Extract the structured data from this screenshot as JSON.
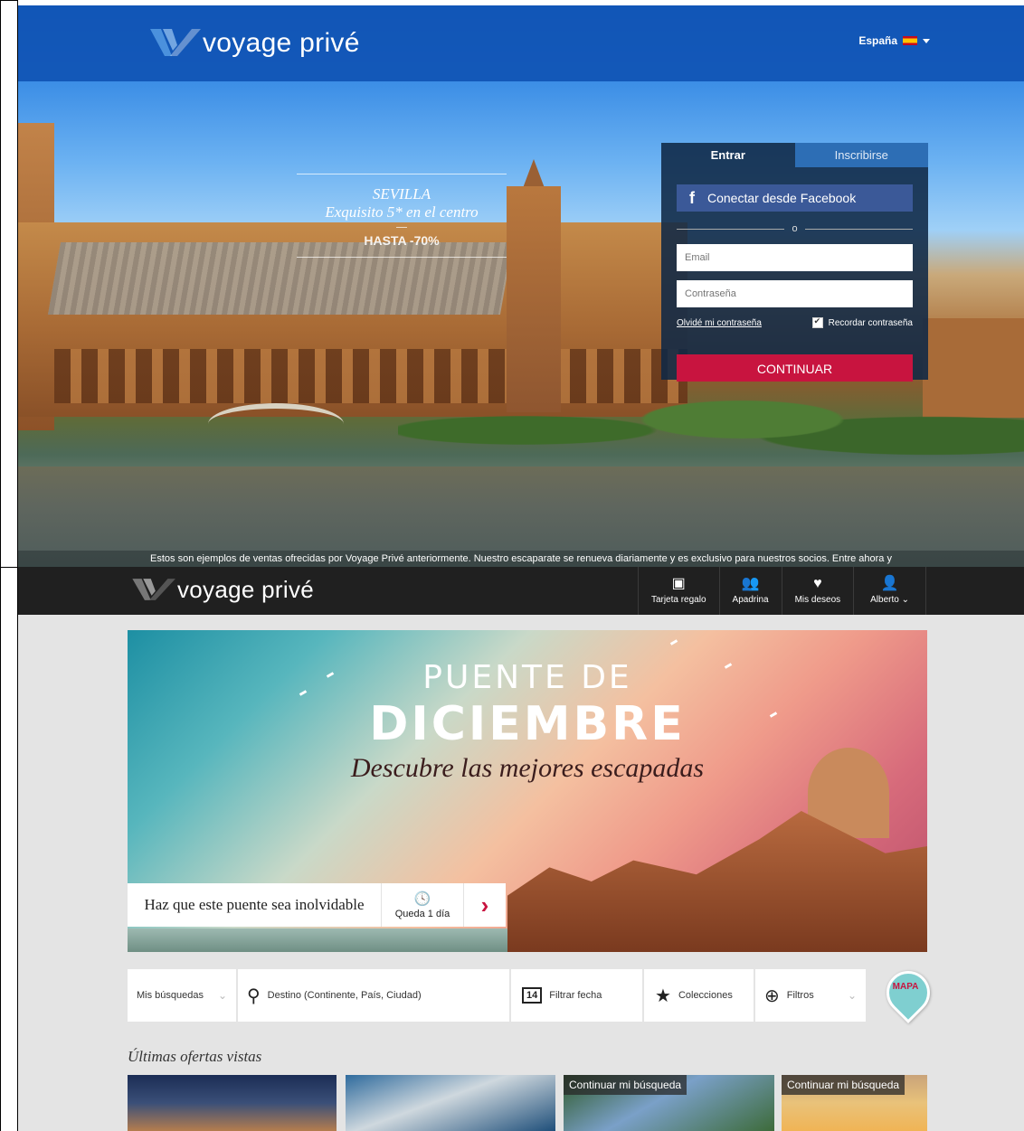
{
  "landing": {
    "logo_text": "voyage privé",
    "country": "España",
    "promo": {
      "city": "SEVILLA",
      "subtitle": "Exquisito 5* en el centro",
      "discount": "HASTA -70%"
    },
    "login": {
      "tab_login": "Entrar",
      "tab_signup": "Inscribirse",
      "facebook_label": "Conectar desde Facebook",
      "or_label": "o",
      "email_placeholder": "Email",
      "password_placeholder": "Contraseña",
      "forgot_label": "Olvidé mi contraseña",
      "remember_label": "Recordar contraseña",
      "continue_label": "CONTINUAR"
    },
    "disclaimer": "Estos son ejemplos de ventas ofrecidas por Voyage Privé anteriormente. Nuestro escaparate se renueva diariamente y es exclusivo para nuestros socios. Entre ahora y"
  },
  "members": {
    "logo_text": "voyage privé",
    "nav": [
      {
        "icon": "gift-card-icon",
        "glyph": "▣",
        "label": "Tarjeta regalo"
      },
      {
        "icon": "sponsor-icon",
        "glyph": "👥",
        "label": "Apadrina"
      },
      {
        "icon": "heart-icon",
        "glyph": "♥",
        "label": "Mis deseos"
      },
      {
        "icon": "user-icon",
        "glyph": "👤",
        "label": "Alberto"
      }
    ],
    "banner": {
      "line1": "PUENTE DE",
      "line2": "DICIEMBRE",
      "line3": "Descubre las mejores escapadas",
      "cta_title": "Haz que este puente sea inolvidable",
      "time_left": "Queda 1 día"
    },
    "search": {
      "my_searches": "Mis búsquedas",
      "destination_placeholder": "Destino (Continente, País, Ciudad)",
      "filter_date": "Filtrar fecha",
      "calendar_day": "14",
      "collections": "Colecciones",
      "filters": "Filtros",
      "map": "MAPA"
    },
    "recent_title": "Últimas ofertas vistas",
    "cards": [
      {
        "overlay": ""
      },
      {
        "overlay": ""
      },
      {
        "overlay": "Continuar mi búsqueda"
      },
      {
        "overlay": "Continuar mi búsqueda"
      }
    ]
  },
  "colors": {
    "brand_blue": "#1054b4",
    "accent_red": "#c8143f",
    "facebook_blue": "#3b5998",
    "header_dark": "#202020"
  }
}
